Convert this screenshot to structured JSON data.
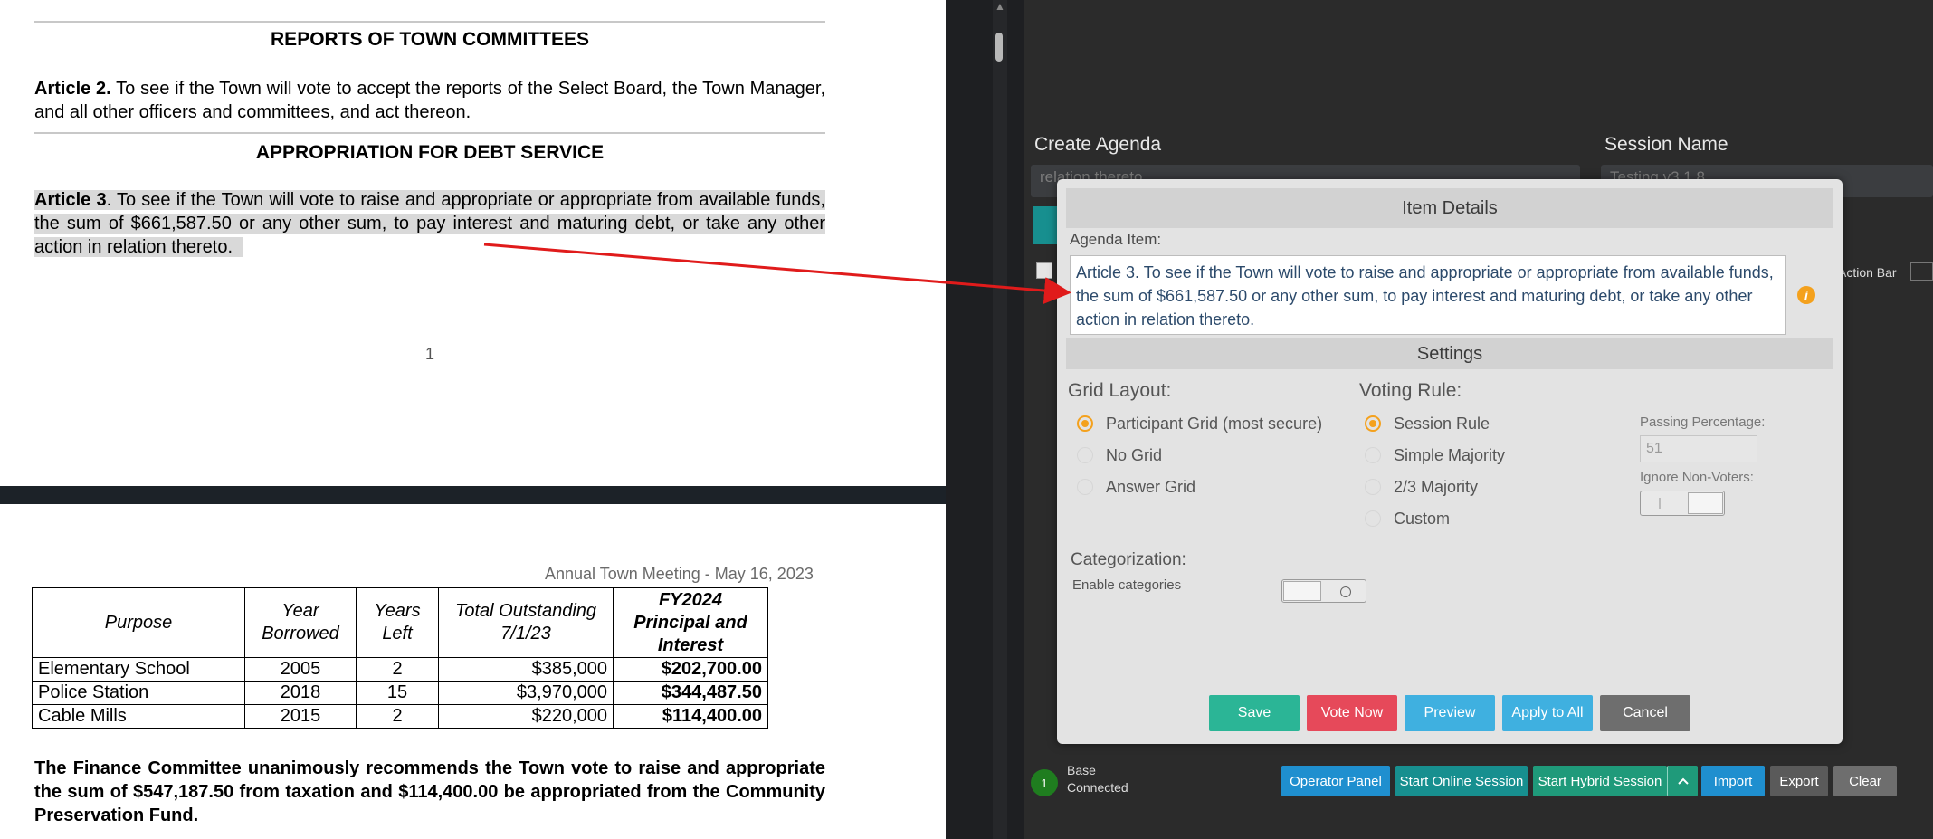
{
  "doc": {
    "heading1": "REPORTS OF TOWN COMMITTEES",
    "article2_bold": "Article 2.",
    "article2_text": " To see if the Town will vote to accept the reports of the Select Board, the Town Manager, and all other officers and committees, and act thereon.",
    "heading2": "APPROPRIATION FOR DEBT SERVICE",
    "article3_bold": "Article 3",
    "article3_text": ". To see if the Town will vote to raise and appropriate or appropriate from available funds, the sum of $661,587.50 or any other sum, to pay interest and maturing debt, or take any other action in relation thereto.",
    "page_number": "1",
    "page2_header": "Annual Town Meeting - May 16, 2023",
    "table": {
      "headers": [
        "Purpose",
        "Year Borrowed",
        "Years Left",
        "Total Outstanding 7/1/23",
        "FY2024 Principal and Interest"
      ],
      "rows": [
        [
          "Elementary School",
          "2005",
          "2",
          "$385,000",
          "$202,700.00"
        ],
        [
          "Police Station",
          "2018",
          "15",
          "$3,970,000",
          "$344,487.50"
        ],
        [
          "Cable Mills",
          "2015",
          "2",
          "$220,000",
          "$114,400.00"
        ]
      ]
    },
    "finance_note": "The Finance Committee unanimously recommends the Town vote to raise and appropriate the sum of $547,187.50 from taxation and $114,400.00 be appropriated from the Community Preservation Fund."
  },
  "app": {
    "create_agenda_label": "Create Agenda",
    "create_agenda_value": "relation thereto.",
    "session_name_label": "Session Name",
    "session_name_value": "Testing v3.1.8",
    "action_bar_label": "Action Bar",
    "modal": {
      "title": "Item Details",
      "agenda_item_label": "Agenda Item:",
      "agenda_item_text": "Article 3. To see if the Town will vote to raise and appropriate or appropriate from available funds, the sum of $661,587.50 or any other sum, to pay interest and maturing debt, or take any other action in relation thereto.",
      "settings_title": "Settings",
      "grid_layout_label": "Grid Layout:",
      "grid_options": [
        "Participant Grid (most secure)",
        "No Grid",
        "Answer Grid"
      ],
      "grid_selected": "Participant Grid (most secure)",
      "voting_rule_label": "Voting Rule:",
      "voting_options": [
        "Session Rule",
        "Simple Majority",
        "2/3 Majority",
        "Custom"
      ],
      "voting_selected": "Session Rule",
      "passing_percentage_label": "Passing Percentage:",
      "passing_percentage_value": "51",
      "ignore_non_voters_label": "Ignore Non-Voters:",
      "ignore_non_voters_on": false,
      "categorization_label": "Categorization:",
      "enable_categories_label": "Enable categories",
      "enable_categories_on": false,
      "buttons": {
        "save": "Save",
        "vote_now": "Vote Now",
        "preview": "Preview",
        "apply_to_all": "Apply to All",
        "cancel": "Cancel"
      }
    },
    "status": {
      "badge": "1",
      "line1": "Base",
      "line2": "Connected"
    },
    "bottom_buttons": {
      "operator_panel": "Operator Panel",
      "start_online": "Start Online Session",
      "start_hybrid": "Start Hybrid Session",
      "import": "Import",
      "export": "Export",
      "clear": "Clear"
    },
    "colors": {
      "save": "#2bb596",
      "vote_now": "#e6495a",
      "preview": "#3fb0e0",
      "apply_to_all": "#3fb0e0",
      "cancel": "#6e6e6e",
      "operator_panel": "#1f8fcf",
      "start_online": "#178f8f",
      "start_hybrid": "#1f9a7a",
      "radio_selected": "#f4a11d",
      "annotation_arrow": "#e01b1b"
    }
  }
}
